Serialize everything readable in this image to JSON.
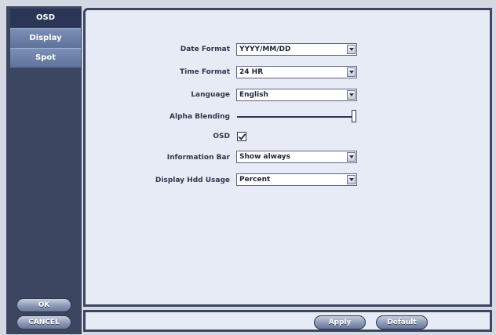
{
  "sidebar": {
    "tabs": [
      {
        "label": "OSD",
        "active": true
      },
      {
        "label": "Display",
        "active": false
      },
      {
        "label": "Spot",
        "active": false
      }
    ],
    "ok_label": "OK",
    "cancel_label": "CANCEL"
  },
  "form": {
    "date_format": {
      "label": "Date Format",
      "value": "YYYY/MM/DD"
    },
    "time_format": {
      "label": "Time Format",
      "value": "24 HR"
    },
    "language": {
      "label": "Language",
      "value": "English"
    },
    "alpha_blending": {
      "label": "Alpha Blending",
      "level": 1.0
    },
    "osd": {
      "label": "OSD",
      "checked": true
    },
    "information_bar": {
      "label": "Information Bar",
      "value": "Show always"
    },
    "display_hdd_usage": {
      "label": "Display Hdd Usage",
      "value": "Percent"
    }
  },
  "footer": {
    "apply_label": "Apply",
    "default_label": "Default"
  },
  "colors": {
    "frame_dark": "#3c4660",
    "panel_bg": "#e7ebf6",
    "active_tab": "#2b3657"
  }
}
